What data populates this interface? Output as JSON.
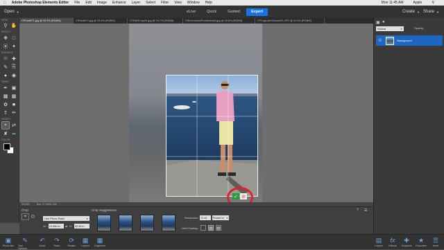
{
  "menubar": {
    "app": "Adobe Photoshop Elements Editor",
    "items": [
      "File",
      "Edit",
      "Image",
      "Enhance",
      "Layer",
      "Select",
      "Filter",
      "View",
      "Window",
      "Help"
    ],
    "clock": "Mon 11:45 AM",
    "user": "Apple"
  },
  "appbar": {
    "open_label": "Open",
    "modes": [
      "eLive",
      "Quick",
      "Guided",
      "Expert"
    ],
    "active_mode": "Expert",
    "create_label": "Create",
    "share_label": "Share"
  },
  "tabs": [
    "CRXwikiT1.jpg @ 33.3% (RGB/8)",
    "CRXwikiT2.jpg @ 33.4% (RGB/8)",
    "CTRAHCrop04.jpg @ 16.7% (RGB/8)",
    "CSfxGraricedFroetlosiest3.jpg @ 43.8% (RGB/8)",
    "CFCapLakeSunsetGS.JPG @ 62.5% (RGB/8)"
  ],
  "toolbar": {
    "sections": [
      "VIEW",
      "SELECT",
      "ENHANCE",
      "DRAW",
      "MODIFY",
      "COLOR"
    ]
  },
  "status": {
    "zoom": "33.33%",
    "doc": "Doc: 17.1M/17.1M"
  },
  "crop_options": {
    "title": "Crop",
    "preset": "Use Photo Ratio",
    "width_label": "W:",
    "width_value": "24.589 in",
    "height_label": "H:",
    "height_value": "32.56 in",
    "suggestions_label": "Crop Suggestions",
    "resolution_label": "Resolution:",
    "resolution_value": "72.44",
    "resolution_unit": "Pixels/Cm",
    "grid_label": "Grid Overlay:"
  },
  "bottombar": {
    "left": [
      "Photo Bin",
      "Tool Options",
      "Undo",
      "Redo",
      "Rotate",
      "Layout",
      "Organizer"
    ],
    "right": [
      "Layers",
      "Effects",
      "Graphics",
      "Favorites",
      "More"
    ]
  },
  "layers_panel": {
    "blend_mode": "Normal",
    "opacity_label": "Opacity:",
    "layer_name": "Background"
  },
  "colors": {
    "accent": "#1473e6",
    "commit": "#2e9a3a",
    "cancel": "#d9242f"
  }
}
